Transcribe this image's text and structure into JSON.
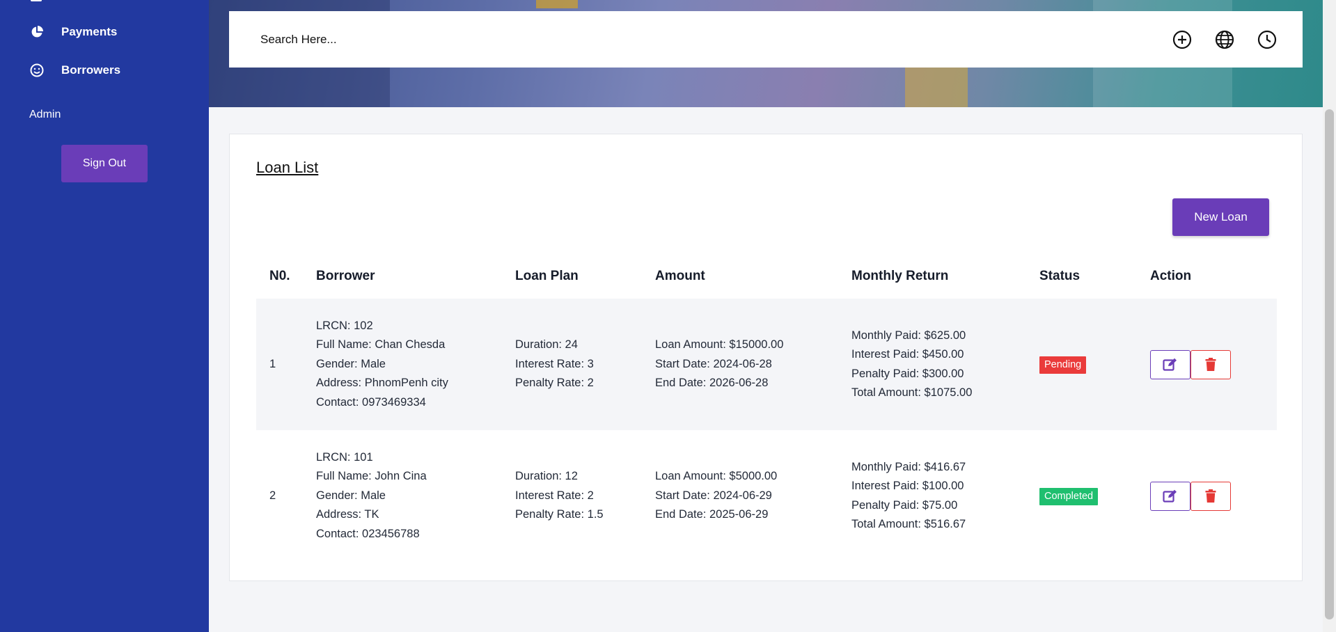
{
  "sidebar": {
    "items": [
      {
        "label": "Payments",
        "icon": "pie-chart-icon"
      },
      {
        "label": "Borrowers",
        "icon": "smile-icon"
      }
    ],
    "section_label": "Admin",
    "sign_out_label": "Sign Out"
  },
  "header": {
    "search_placeholder": "Search Here...",
    "icons": [
      "plus-circle-icon",
      "globe-icon",
      "clock-icon"
    ]
  },
  "main": {
    "title": "Loan List",
    "new_loan_label": "New Loan",
    "columns": [
      "N0.",
      "Borrower",
      "Loan Plan",
      "Amount",
      "Monthly Return",
      "Status",
      "Action"
    ],
    "rows": [
      {
        "no": "1",
        "borrower": [
          "LRCN: 102",
          "Full Name: Chan Chesda",
          "Gender: Male",
          "Address: PhnomPenh city",
          "Contact: 0973469334"
        ],
        "plan": [
          "Duration: 24",
          "Interest Rate: 3",
          "Penalty Rate: 2"
        ],
        "amount": [
          "Loan Amount: $15000.00",
          "Start Date: 2024-06-28",
          "End Date: 2026-06-28"
        ],
        "monthly": [
          "Monthly Paid: $625.00",
          "Interest Paid: $450.00",
          "Penalty Paid: $300.00",
          "Total Amount: $1075.00"
        ],
        "status": "Pending",
        "status_color": "#ea3b3b"
      },
      {
        "no": "2",
        "borrower": [
          "LRCN: 101",
          "Full Name: John Cina",
          "Gender: Male",
          "Address: TK",
          "Contact: 023456788"
        ],
        "plan": [
          "Duration: 12",
          "Interest Rate: 2",
          "Penalty Rate: 1.5"
        ],
        "amount": [
          "Loan Amount: $5000.00",
          "Start Date: 2024-06-29",
          "End Date: 2025-06-29"
        ],
        "monthly": [
          "Monthly Paid: $416.67",
          "Interest Paid: $100.00",
          "Penalty Paid: $75.00",
          "Total Amount: $516.67"
        ],
        "status": "Completed",
        "status_color": "#1fbf6f"
      }
    ]
  },
  "colors": {
    "sidebar_bg": "#2239a0",
    "accent_purple": "#6a3db8",
    "danger_red": "#e53935"
  }
}
